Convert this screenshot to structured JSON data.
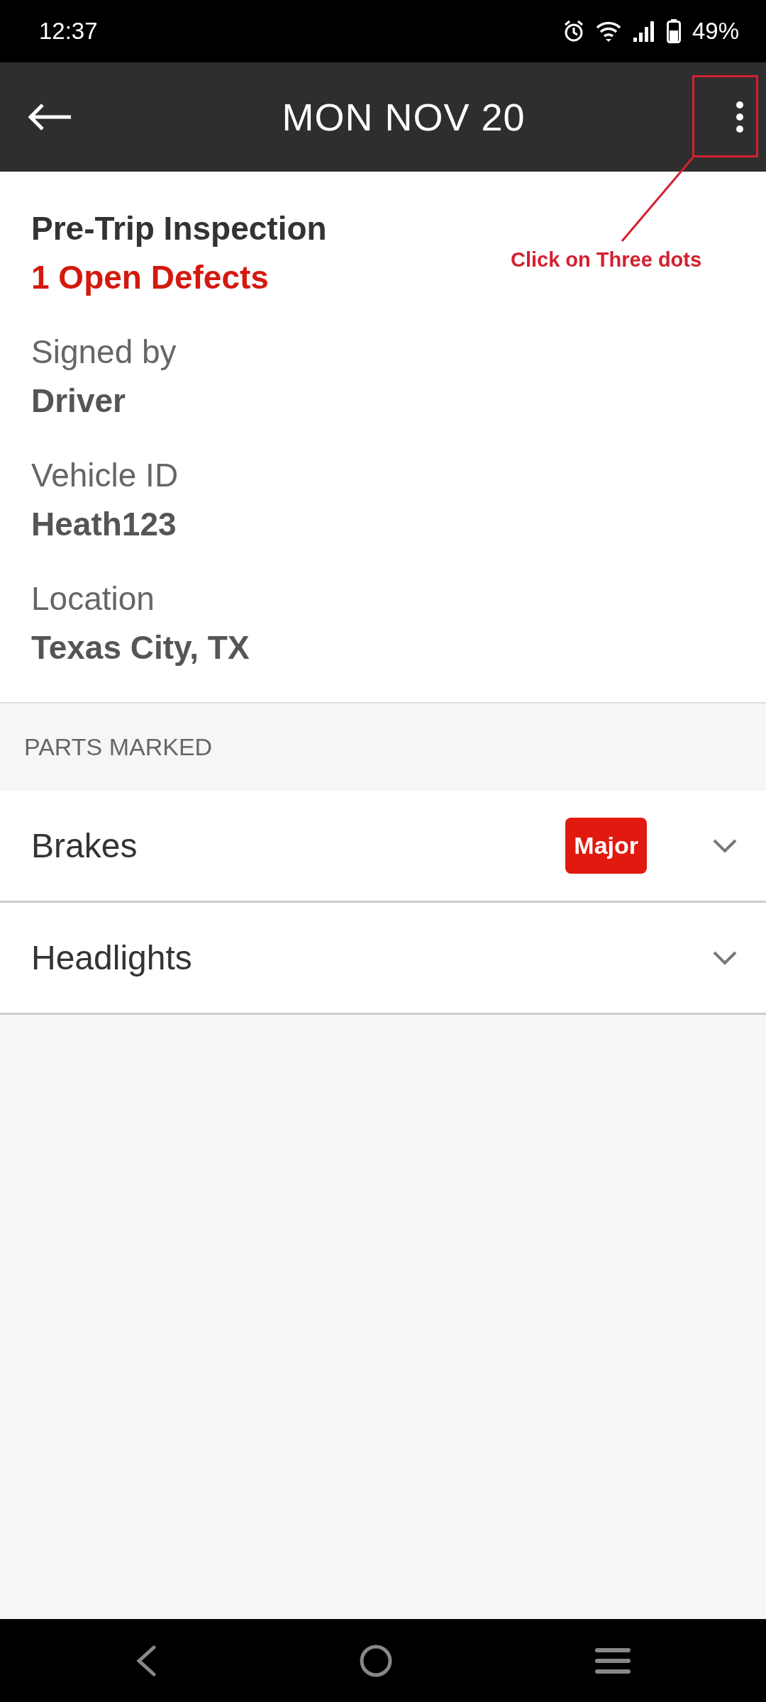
{
  "status_bar": {
    "time": "12:37",
    "battery": "49%"
  },
  "header": {
    "title": "MON NOV 20"
  },
  "inspection": {
    "title": "Pre-Trip Inspection",
    "defects": "1 Open Defects",
    "fields": [
      {
        "label": "Signed by",
        "value": "Driver"
      },
      {
        "label": "Vehicle ID",
        "value": "Heath123"
      },
      {
        "label": "Location",
        "value": "Texas City, TX"
      }
    ]
  },
  "parts": {
    "heading": "PARTS MARKED",
    "items": [
      {
        "name": "Brakes",
        "badge": "Major",
        "expanded": false
      },
      {
        "name": "Headlights",
        "expanded": false
      }
    ]
  },
  "annotation": {
    "text": "Click on Three dots"
  }
}
